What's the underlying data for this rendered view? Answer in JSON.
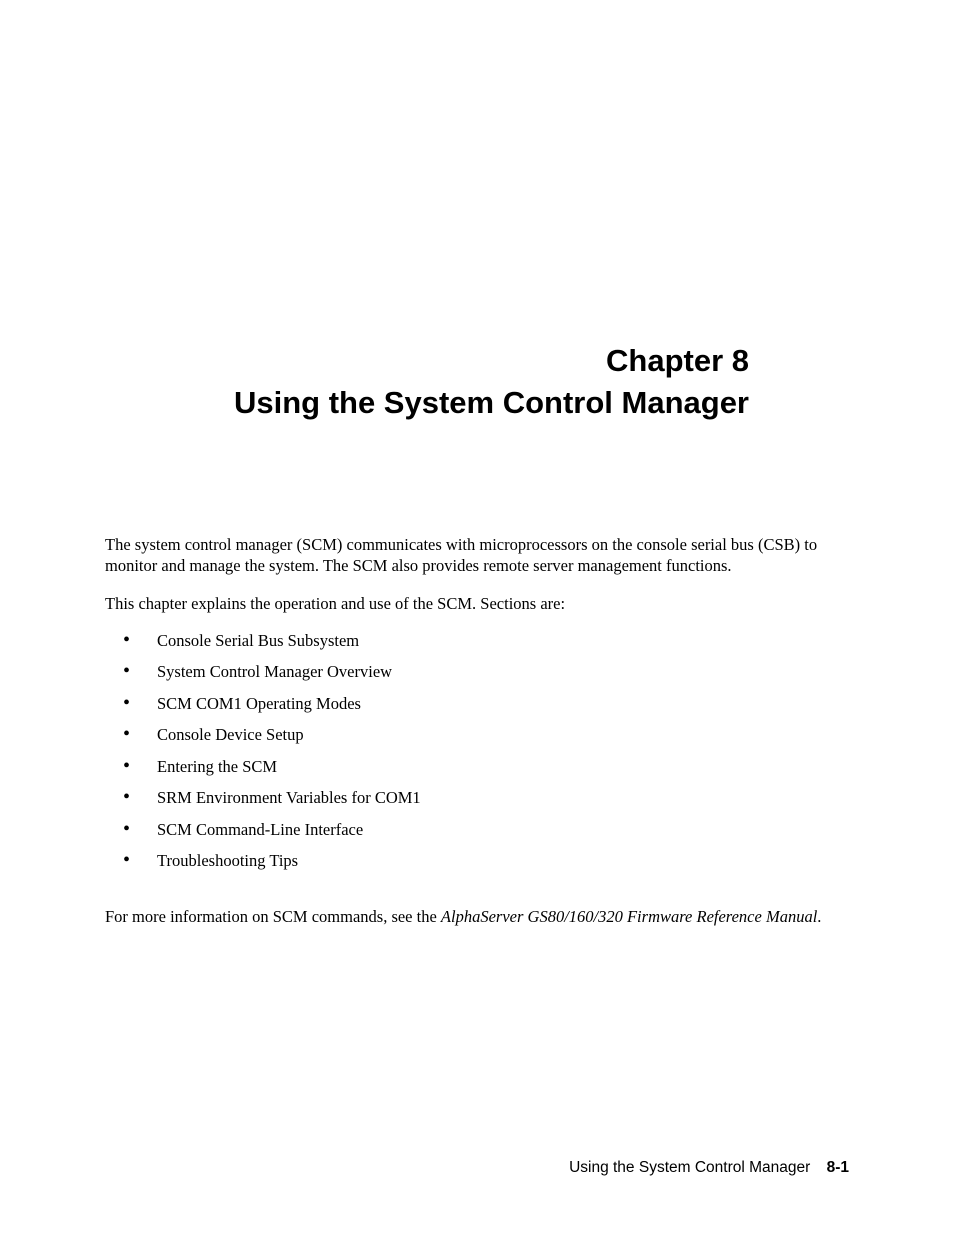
{
  "heading": {
    "line1": "Chapter 8",
    "line2": "Using the System Control Manager"
  },
  "paragraphs": {
    "intro1": "The system control manager (SCM) communicates with microprocessors on the console serial bus (CSB) to monitor and manage the system.  The SCM also provides remote server management functions.",
    "intro2": "This chapter explains the operation and use of the SCM.  Sections are:"
  },
  "sections": [
    "Console Serial Bus Subsystem",
    "System Control Manager Overview",
    "SCM COM1 Operating Modes",
    "Console Device Setup",
    "Entering the SCM",
    "SRM Environment Variables for COM1",
    "SCM Command-Line Interface",
    "Troubleshooting Tips"
  ],
  "reference": {
    "prefix": "For more information on SCM commands, see the ",
    "title": "AlphaServer GS80/160/320 Firmware Reference Manual",
    "suffix": "."
  },
  "footer": {
    "title": "Using the System Control Manager",
    "page": "8-1"
  }
}
